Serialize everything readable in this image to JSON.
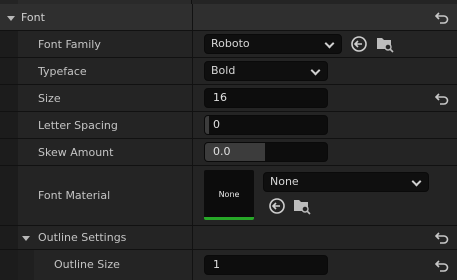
{
  "category": {
    "label": "Font"
  },
  "font_family": {
    "label": "Font Family",
    "value": "Roboto"
  },
  "typeface": {
    "label": "Typeface",
    "value": "Bold"
  },
  "size": {
    "label": "Size",
    "value": "16"
  },
  "letter_spacing": {
    "label": "Letter Spacing",
    "value": "0"
  },
  "skew_amount": {
    "label": "Skew Amount",
    "value": "0.0"
  },
  "font_material": {
    "label": "Font Material",
    "thumbnail_label": "None",
    "value": "None"
  },
  "outline_settings": {
    "label": "Outline Settings"
  },
  "outline_size": {
    "label": "Outline Size",
    "value": "1"
  },
  "colors": {
    "thumbnail_accent": "#27a828",
    "panel": "#242424",
    "category": "#2f2f2f"
  }
}
